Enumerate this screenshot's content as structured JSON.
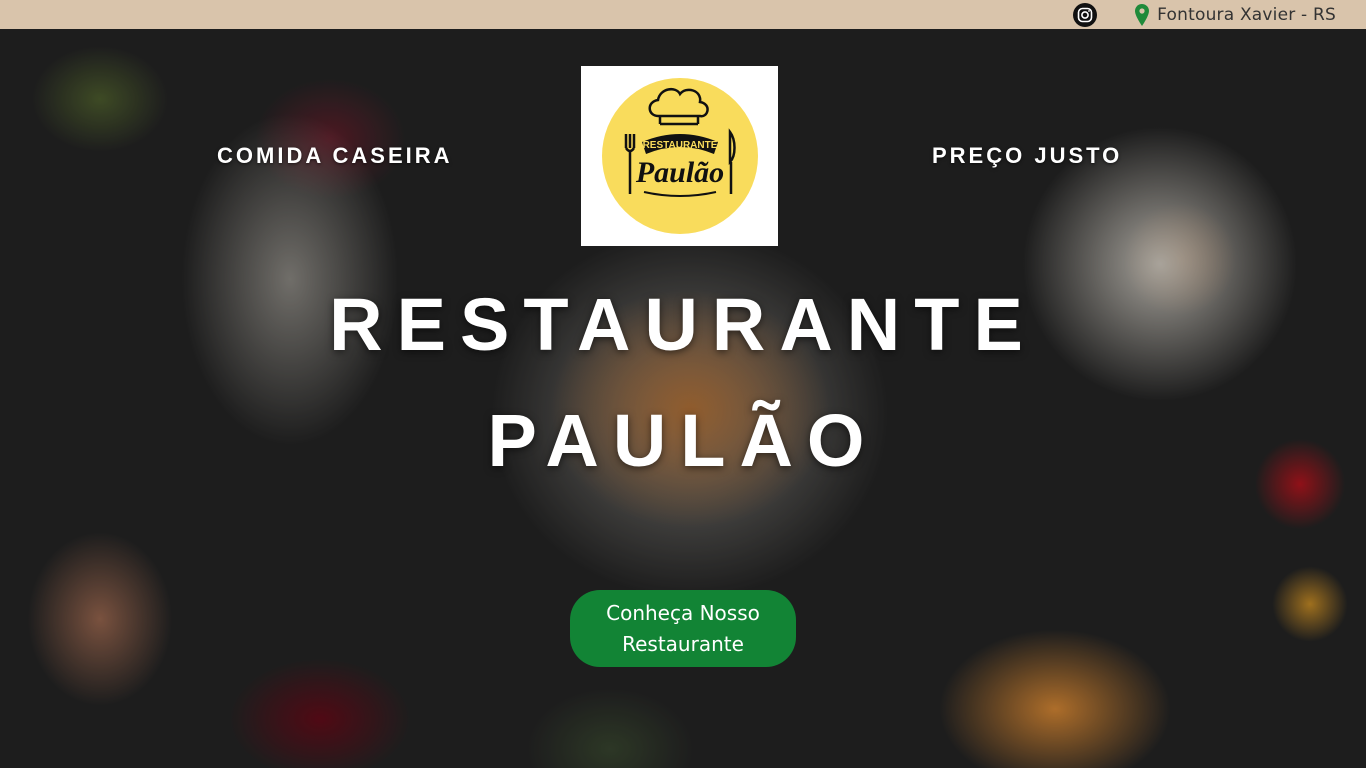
{
  "topbar": {
    "instagram_icon": "instagram-icon",
    "location_icon": "map-pin-icon",
    "location": "Fontoura Xavier - RS",
    "pin_color": "#1f8a3a",
    "background": "#d9c4ab"
  },
  "hero": {
    "left_tag": "COMIDA CASEIRA",
    "right_tag": "PREÇO JUSTO",
    "logo": {
      "line1": "RESTAURANTE",
      "line2": "Paulão",
      "circle_color": "#f9dc5c"
    },
    "title_line1": "RESTAURANTE",
    "title_line2": "PAULÃO",
    "cta_label": "Conheça Nosso Restaurante",
    "cta_color": "#128435"
  }
}
